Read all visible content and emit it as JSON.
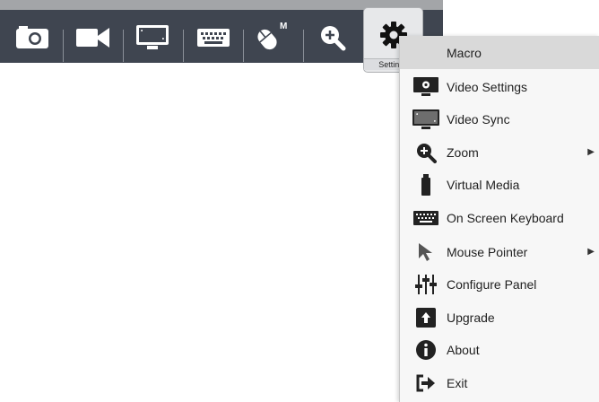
{
  "toolbar": {
    "buttons": [
      {
        "icon": "camera-icon"
      },
      {
        "icon": "video-camera-icon"
      },
      {
        "icon": "monitor-icon"
      },
      {
        "icon": "keyboard-icon"
      },
      {
        "icon": "mouse-icon",
        "badge": "M"
      },
      {
        "icon": "zoom-in-icon"
      }
    ],
    "settings_label": "Settings",
    "settings_icon": "gear-icon"
  },
  "menu": {
    "items": [
      {
        "label": "Macro",
        "icon": "macro-icon",
        "highlighted": true
      },
      {
        "label": "Video Settings",
        "icon": "video-settings-icon"
      },
      {
        "label": "Video Sync",
        "icon": "video-sync-icon"
      },
      {
        "label": "Zoom",
        "icon": "zoom-icon",
        "submenu": true
      },
      {
        "label": "Virtual Media",
        "icon": "usb-drive-icon"
      },
      {
        "label": "On Screen Keyboard",
        "icon": "keyboard-icon"
      },
      {
        "label": "Mouse Pointer",
        "icon": "pointer-icon",
        "submenu": true
      },
      {
        "label": "Configure Panel",
        "icon": "sliders-icon"
      },
      {
        "label": "Upgrade",
        "icon": "upgrade-icon"
      },
      {
        "label": "About",
        "icon": "info-icon"
      },
      {
        "label": "Exit",
        "icon": "exit-icon"
      }
    ]
  },
  "colors": {
    "toolbar_bg": "#3f4550",
    "menu_bg": "#f7f7f7",
    "highlight": "#d9d9d9"
  }
}
